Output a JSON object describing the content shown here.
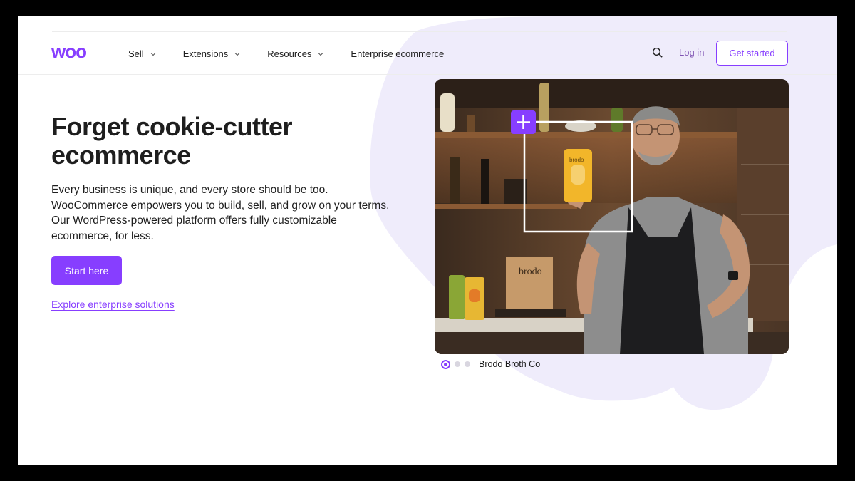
{
  "header": {
    "logo_text": "woo",
    "nav": [
      {
        "label": "Sell",
        "has_dropdown": true
      },
      {
        "label": "Extensions",
        "has_dropdown": true
      },
      {
        "label": "Resources",
        "has_dropdown": true
      },
      {
        "label": "Enterprise ecommerce",
        "has_dropdown": false
      }
    ],
    "search_icon": "search-icon",
    "login_label": "Log in",
    "cta_label": "Get started"
  },
  "hero": {
    "title": "Forget cookie-cutter ecommerce",
    "description": "Every business is unique, and every store should be too. WooCommerce empowers you to build, sell, and grow on your terms. Our WordPress-powered platform offers fully customizable ecommerce, for less.",
    "primary_button": "Start here",
    "secondary_link": "Explore enterprise solutions"
  },
  "showcase": {
    "caption": "Brodo Broth Co",
    "slides_count": 3,
    "active_slide": 1,
    "package_label": "brodo",
    "book_label": "brodo"
  },
  "colors": {
    "brand_purple": "#873eff",
    "link_purple": "#7f54b3",
    "blob_lavender": "#efecfb"
  }
}
